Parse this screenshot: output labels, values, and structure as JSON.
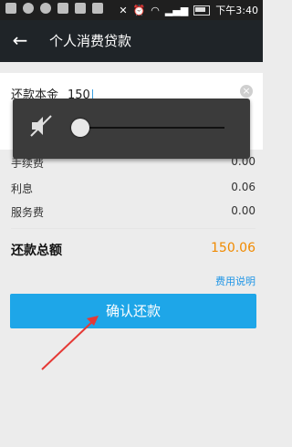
{
  "statusbar": {
    "time": "下午3:40"
  },
  "header": {
    "back_icon": "arrow-left-icon",
    "title": "个人消费贷款"
  },
  "form": {
    "amount_label": "还款本金",
    "amount_value": "150",
    "clear_icon": "clear-icon"
  },
  "fees": [
    {
      "label": "手续费",
      "value": "0.00"
    },
    {
      "label": "利息",
      "value": "0.06"
    },
    {
      "label": "服务费",
      "value": "0.00"
    }
  ],
  "total": {
    "label": "还款总额",
    "value": "150.06"
  },
  "fee_link": "费用说明",
  "confirm_button": "确认还款",
  "volume_popup": {
    "icon": "mute-icon",
    "level": 0
  },
  "colors": {
    "accent": "#1ea6e8",
    "total": "#f08a00",
    "link": "#2196e6",
    "annotation_arrow": "#e53935"
  }
}
